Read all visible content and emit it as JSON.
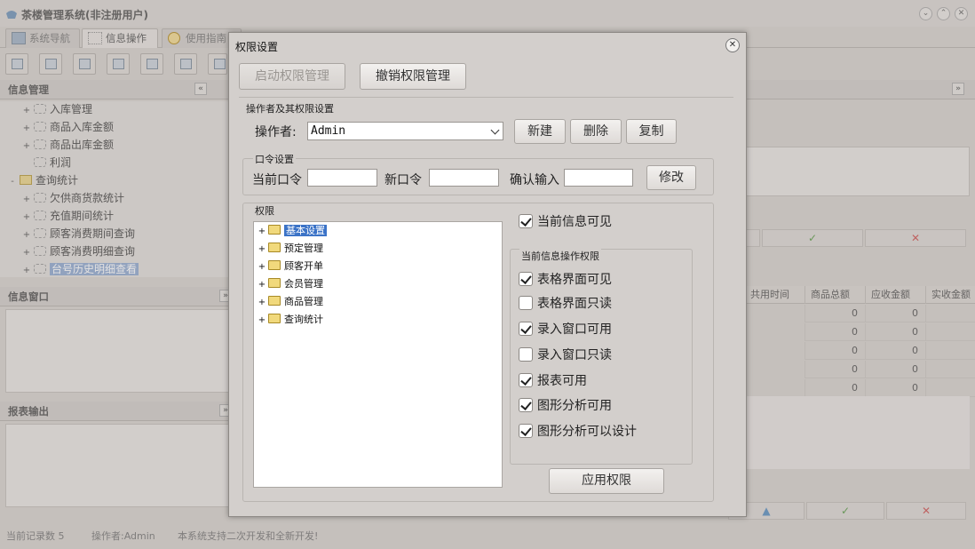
{
  "app": {
    "title": "茶楼管理系统(非注册用户)",
    "tabs": [
      "系统导航",
      "信息操作",
      "使用指南"
    ]
  },
  "left": {
    "info_header": "信息管理",
    "tree": [
      {
        "label": "入库管理",
        "level": 2,
        "expander": "+"
      },
      {
        "label": "商品入库金额",
        "level": 2,
        "expander": "+"
      },
      {
        "label": "商品出库金额",
        "level": 2,
        "expander": "+"
      },
      {
        "label": "利润",
        "level": 2,
        "expander": ""
      },
      {
        "label": "查询统计",
        "level": 1,
        "expander": "-"
      },
      {
        "label": "欠供商货款统计",
        "level": 2,
        "expander": "+"
      },
      {
        "label": "充值期间统计",
        "level": 2,
        "expander": "+"
      },
      {
        "label": "顾客消费期间查询",
        "level": 2,
        "expander": "+"
      },
      {
        "label": "顾客消费明细查询",
        "level": 2,
        "expander": "+"
      },
      {
        "label": "台号历史明细查看",
        "level": 2,
        "expander": "+"
      }
    ],
    "info_window_header": "信息窗口",
    "report_header": "报表输出"
  },
  "grid": {
    "columns": [
      "共用时间",
      "商品总额",
      "应收金额",
      "实收金额"
    ],
    "rows": [
      [
        "0",
        "0"
      ],
      [
        "0",
        "0"
      ],
      [
        "0",
        "0"
      ],
      [
        "0",
        "0"
      ],
      [
        "0",
        "0"
      ]
    ]
  },
  "status": {
    "record_count": "当前记录数 5",
    "operator": "操作者:Admin",
    "note": "本系统支持二次开发和全新开发!"
  },
  "dialog": {
    "title": "权限设置",
    "enable_btn": "启动权限管理",
    "revoke_btn": "撤销权限管理",
    "operator_group": "操作者及其权限设置",
    "operator_label": "操作者:",
    "operator_value": "Admin",
    "new_btn": "新建",
    "delete_btn": "删除",
    "copy_btn": "复制",
    "password_group": "口令设置",
    "current_pw_label": "当前口令",
    "new_pw_label": "新口令",
    "confirm_pw_label": "确认输入",
    "modify_btn": "修改",
    "perm_group": "权限",
    "perm_tree": [
      "基本设置",
      "预定管理",
      "顾客开单",
      "会员管理",
      "商品管理",
      "查询统计"
    ],
    "current_visible": "当前信息可见",
    "ops_group": "当前信息操作权限",
    "ops": [
      {
        "label": "表格界面可见",
        "checked": true
      },
      {
        "label": "表格界面只读",
        "checked": false
      },
      {
        "label": "录入窗口可用",
        "checked": true
      },
      {
        "label": "录入窗口只读",
        "checked": false
      },
      {
        "label": "报表可用",
        "checked": true
      },
      {
        "label": "图形分析可用",
        "checked": true
      },
      {
        "label": "图形分析可以设计",
        "checked": true
      }
    ],
    "apply_btn": "应用权限"
  }
}
